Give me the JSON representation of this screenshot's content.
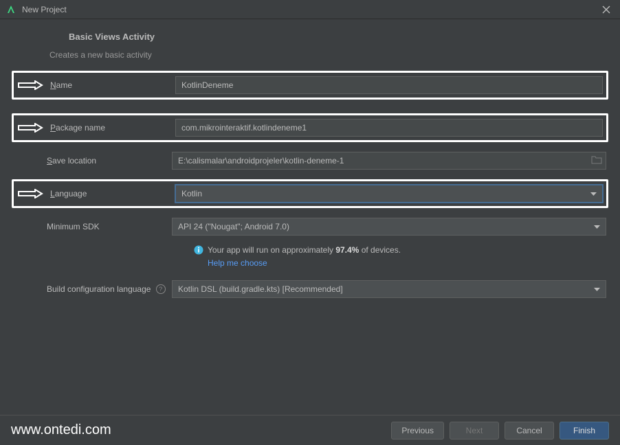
{
  "titlebar": {
    "title": "New Project"
  },
  "section": {
    "title": "Basic Views Activity",
    "subtitle": "Creates a new basic activity"
  },
  "fields": {
    "name": {
      "label": "Name",
      "value": "KotlinDeneme"
    },
    "package": {
      "label": "Package name",
      "value": "com.mikrointeraktif.kotlindeneme1"
    },
    "save": {
      "label": "Save location",
      "value": "E:\\calismalar\\androidprojeler\\kotlin-deneme-1"
    },
    "language": {
      "label": "Language",
      "value": "Kotlin"
    },
    "minsdk": {
      "label": "Minimum SDK",
      "value": "API 24 (\"Nougat\"; Android 7.0)"
    },
    "buildconf": {
      "label": "Build configuration language",
      "value": "Kotlin DSL (build.gradle.kts) [Recommended]"
    }
  },
  "info": {
    "prefix": "Your app will run on approximately ",
    "percent": "97.4%",
    "suffix": " of devices.",
    "help_link": "Help me choose"
  },
  "footer": {
    "watermark": "www.ontedi.com",
    "previous": "Previous",
    "next": "Next",
    "cancel": "Cancel",
    "finish": "Finish"
  }
}
